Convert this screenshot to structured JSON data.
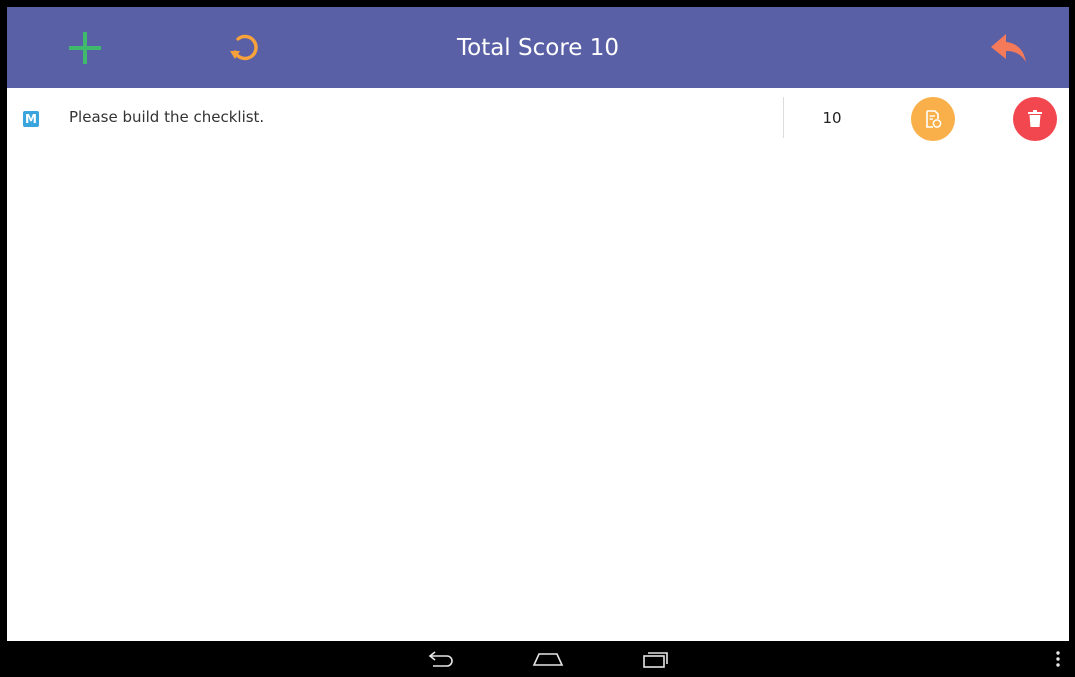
{
  "header": {
    "title": "Total Score 10",
    "icons": {
      "add": "plus-icon",
      "refresh": "refresh-icon",
      "back": "reply-arrow-icon"
    },
    "colors": {
      "bar": "#5a60a6",
      "add": "#3fb96b",
      "refresh": "#f7a23b",
      "back": "#f47a5a"
    }
  },
  "items": [
    {
      "badge": "M",
      "badge_color": "#3aa5dd",
      "text": "Please build the checklist.",
      "score": "10",
      "edit_icon": "document-edit-icon",
      "edit_color": "#f9b04a",
      "delete_icon": "trash-icon",
      "delete_color": "#f2474e"
    }
  ],
  "navbar": {
    "icons": [
      "back-nav-icon",
      "home-nav-icon",
      "recent-apps-icon",
      "overflow-menu-icon"
    ]
  }
}
